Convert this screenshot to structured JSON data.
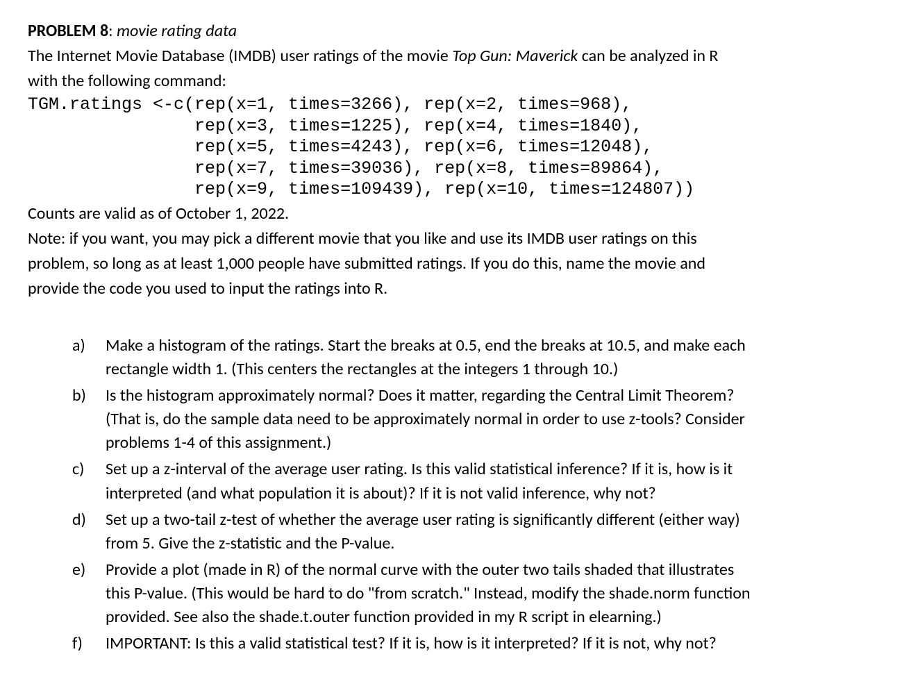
{
  "problem": {
    "label": "PROBLEM 8",
    "colon": ": ",
    "title_italic": "movie rating data"
  },
  "intro": {
    "line1_pre": "The Internet Movie Database (IMDB) user ratings of the movie ",
    "line1_italic": "Top Gun: Maverick",
    "line1_post": " can be analyzed in R",
    "line2": "with the following command:"
  },
  "code": "TGM.ratings <-c(rep(x=1, times=3266), rep(x=2, times=968),\n                rep(x=3, times=1225), rep(x=4, times=1840),\n                rep(x=5, times=4243), rep(x=6, times=12048),\n                rep(x=7, times=39036), rep(x=8, times=89864),\n                rep(x=9, times=109439), rep(x=10, times=124807))",
  "counts_line": "Counts are valid as of October 1, 2022.",
  "note": {
    "l1": "Note: if you want, you may pick a different movie that you like and use its IMDB user ratings on this",
    "l2": "problem, so long as at least 1,000 people have submitted ratings. If you do this, name the movie and",
    "l3": "provide the code you used to input the ratings into R."
  },
  "questions": [
    {
      "marker": "a)",
      "lines": [
        "Make a histogram of the ratings. Start the breaks at 0.5, end the breaks at 10.5, and make each",
        "rectangle width 1. (This centers the rectangles at the integers 1 through 10.)"
      ]
    },
    {
      "marker": "b)",
      "lines": [
        "Is the histogram approximately normal? Does it matter, regarding the Central Limit Theorem?",
        "(That is, do the sample data need to be approximately normal in order to use z-tools? Consider",
        "problems 1-4 of this assignment.)"
      ]
    },
    {
      "marker": "c)",
      "lines": [
        "Set up a z-interval of the average user rating. Is this valid statistical inference? If it is, how is it",
        "interpreted (and what population it is about)? If it is not valid inference, why not?"
      ]
    },
    {
      "marker": "d)",
      "lines": [
        "Set up a two-tail z-test of whether the average user rating is significantly different (either way)",
        "from 5. Give the z-statistic and the P-value."
      ]
    },
    {
      "marker": "e)",
      "lines": [
        "Provide a plot (made in R) of the normal curve with the outer two tails shaded that illustrates",
        "this P-value. (This would be hard to do \"from scratch.\" Instead, modify the shade.norm function",
        "provided. See also the shade.t.outer function provided in my R script in elearning.)"
      ]
    },
    {
      "marker": "f)",
      "lines": [
        "IMPORTANT: Is this a valid statistical test? If it is, how is it interpreted? If it is not, why not?"
      ]
    }
  ]
}
